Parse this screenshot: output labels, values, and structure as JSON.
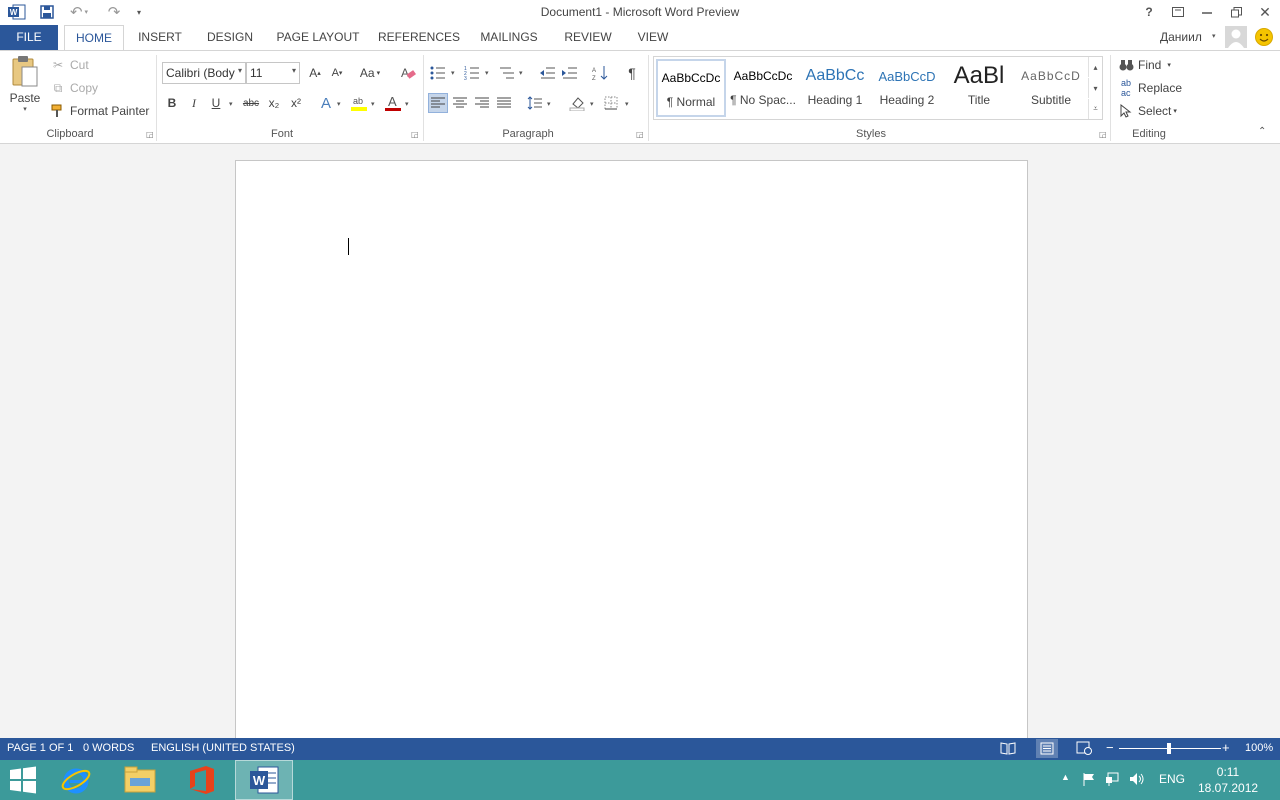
{
  "titlebar": {
    "title": "Document1 - Microsoft Word Preview",
    "help": "?",
    "user": "Даниил"
  },
  "tabs": [
    {
      "label": "FILE"
    },
    {
      "label": "HOME"
    },
    {
      "label": "INSERT"
    },
    {
      "label": "DESIGN"
    },
    {
      "label": "PAGE LAYOUT"
    },
    {
      "label": "REFERENCES"
    },
    {
      "label": "MAILINGS"
    },
    {
      "label": "REVIEW"
    },
    {
      "label": "VIEW"
    }
  ],
  "clipboard": {
    "paste": "Paste",
    "cut": "Cut",
    "copy": "Copy",
    "format_painter": "Format Painter",
    "group": "Clipboard"
  },
  "font": {
    "name": "Calibri (Body",
    "size": "11",
    "change_case": "Aa",
    "bold": "B",
    "italic": "I",
    "underline": "U",
    "strike": "abc",
    "subscript": "x₂",
    "superscript": "x²",
    "group": "Font"
  },
  "paragraph": {
    "group": "Paragraph"
  },
  "styles": {
    "items": [
      {
        "preview": "AaBbCcDc",
        "name": "¶ Normal"
      },
      {
        "preview": "AaBbCcDc",
        "name": "¶ No Spac..."
      },
      {
        "preview": "AaBbCc",
        "name": "Heading 1"
      },
      {
        "preview": "AaBbCcD",
        "name": "Heading 2"
      },
      {
        "preview": "AaBl",
        "name": "Title"
      },
      {
        "preview": "AaBbCcD",
        "name": "Subtitle"
      }
    ],
    "group": "Styles"
  },
  "editing": {
    "find": "Find",
    "replace": "Replace",
    "select": "Select",
    "group": "Editing"
  },
  "status": {
    "page": "PAGE 1 OF 1",
    "words": "0 WORDS",
    "language": "ENGLISH (UNITED STATES)",
    "zoom_level": "100%"
  },
  "taskbar": {
    "lang": "ENG",
    "time": "0:11",
    "date": "18.07.2012"
  },
  "colors": {
    "word_blue": "#2b579a",
    "taskbar": "#3c9a9a",
    "highlight": "#ffff00",
    "font_color": "#c00000"
  }
}
